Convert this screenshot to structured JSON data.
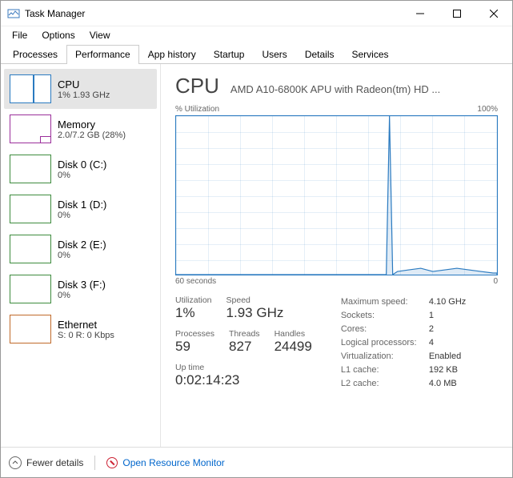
{
  "window": {
    "title": "Task Manager"
  },
  "menus": [
    "File",
    "Options",
    "View"
  ],
  "tabs": [
    "Processes",
    "Performance",
    "App history",
    "Startup",
    "Users",
    "Details",
    "Services"
  ],
  "active_tab": 1,
  "sidebar": [
    {
      "name": "CPU",
      "sub": "1% 1.93 GHz",
      "kind": "cpu",
      "selected": true
    },
    {
      "name": "Memory",
      "sub": "2.0/7.2 GB (28%)",
      "kind": "mem"
    },
    {
      "name": "Disk 0 (C:)",
      "sub": "0%",
      "kind": "disk"
    },
    {
      "name": "Disk 1 (D:)",
      "sub": "0%",
      "kind": "disk"
    },
    {
      "name": "Disk 2 (E:)",
      "sub": "0%",
      "kind": "disk"
    },
    {
      "name": "Disk 3 (F:)",
      "sub": "0%",
      "kind": "disk"
    },
    {
      "name": "Ethernet",
      "sub": "S: 0 R: 0 Kbps",
      "kind": "eth"
    }
  ],
  "detail": {
    "heading": "CPU",
    "device": "AMD A10-6800K APU with Radeon(tm) HD ...",
    "top_left_label": "% Utilization",
    "top_right_label": "100%",
    "bottom_left_label": "60 seconds",
    "bottom_right_label": "0",
    "stats": {
      "utilization_label": "Utilization",
      "utilization_value": "1%",
      "speed_label": "Speed",
      "speed_value": "1.93 GHz",
      "processes_label": "Processes",
      "processes_value": "59",
      "threads_label": "Threads",
      "threads_value": "827",
      "handles_label": "Handles",
      "handles_value": "24499",
      "uptime_label": "Up time",
      "uptime_value": "0:02:14:23"
    },
    "kv": {
      "max_speed_k": "Maximum speed:",
      "max_speed_v": "4.10 GHz",
      "sockets_k": "Sockets:",
      "sockets_v": "1",
      "cores_k": "Cores:",
      "cores_v": "2",
      "lp_k": "Logical processors:",
      "lp_v": "4",
      "virt_k": "Virtualization:",
      "virt_v": "Enabled",
      "l1_k": "L1 cache:",
      "l1_v": "192 KB",
      "l2_k": "L2 cache:",
      "l2_v": "4.0 MB"
    }
  },
  "footer": {
    "fewer": "Fewer details",
    "resmon": "Open Resource Monitor"
  },
  "chart_data": {
    "type": "line",
    "title": "% Utilization",
    "xlabel": "60 seconds",
    "ylabel": "",
    "ylim": [
      0,
      100
    ],
    "x_seconds_ago": [
      60,
      58,
      56,
      54,
      52,
      50,
      48,
      46,
      44,
      42,
      40,
      38,
      36,
      34,
      32,
      30,
      28,
      26,
      24,
      22,
      20,
      18,
      16,
      14,
      12,
      10,
      8,
      6,
      4,
      2,
      0
    ],
    "utilization_pct": [
      0,
      0,
      0,
      0,
      0,
      0,
      0,
      0,
      0,
      0,
      0,
      0,
      0,
      0,
      0,
      0,
      0,
      0,
      0,
      0,
      100,
      2,
      3,
      4,
      2,
      3,
      4,
      3,
      2,
      2,
      1
    ]
  }
}
